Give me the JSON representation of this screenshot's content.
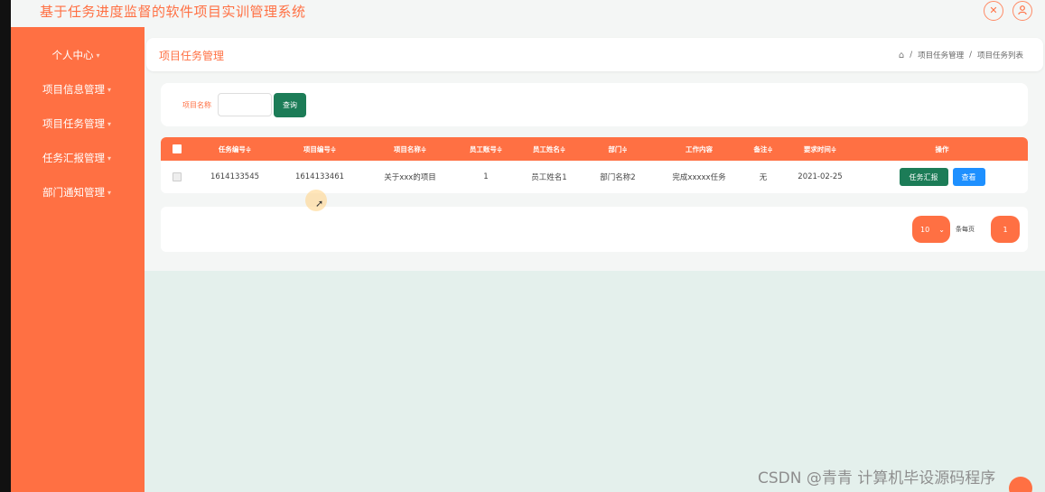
{
  "app": {
    "title": "基于任务进度监督的软件项目实训管理系统"
  },
  "topbar": {
    "fullscreen_icon": "close-circle-icon",
    "user_icon": "user-icon"
  },
  "sidebar": {
    "items": [
      {
        "label": "个人中心"
      },
      {
        "label": "项目信息管理"
      },
      {
        "label": "项目任务管理"
      },
      {
        "label": "任务汇报管理"
      },
      {
        "label": "部门通知管理"
      }
    ],
    "caret": "▾"
  },
  "page": {
    "title": "项目任务管理",
    "breadcrumb": {
      "separator": "/",
      "items": [
        "项目任务管理",
        "项目任务列表"
      ]
    }
  },
  "search": {
    "label": "项目名称",
    "value": "",
    "placeholder": "",
    "button_label": "查询"
  },
  "table": {
    "columns": [
      "任务编号≑",
      "项目编号≑",
      "项目名称≑",
      "员工账号≑",
      "员工姓名≑",
      "部门≑",
      "工作内容",
      "备注≑",
      "要求时间≑",
      "操作"
    ],
    "rows": [
      {
        "cells": [
          "1614133545",
          "1614133461",
          "关于xxx的项目",
          "1",
          "员工姓名1",
          "部门名称2",
          "完成xxxxx任务",
          "无",
          "2021-02-25"
        ],
        "actions": {
          "report": "任务汇报",
          "view": "查看"
        }
      }
    ]
  },
  "pagination": {
    "page_size": "10",
    "page_size_label": "条每页",
    "current_page": "1"
  },
  "watermark": "CSDN @青青  计算机毕设源码程序",
  "colors": {
    "accent": "#ff7043",
    "green": "#1c7c57",
    "blue": "#1e90ff",
    "background": "#e4f0ec"
  }
}
